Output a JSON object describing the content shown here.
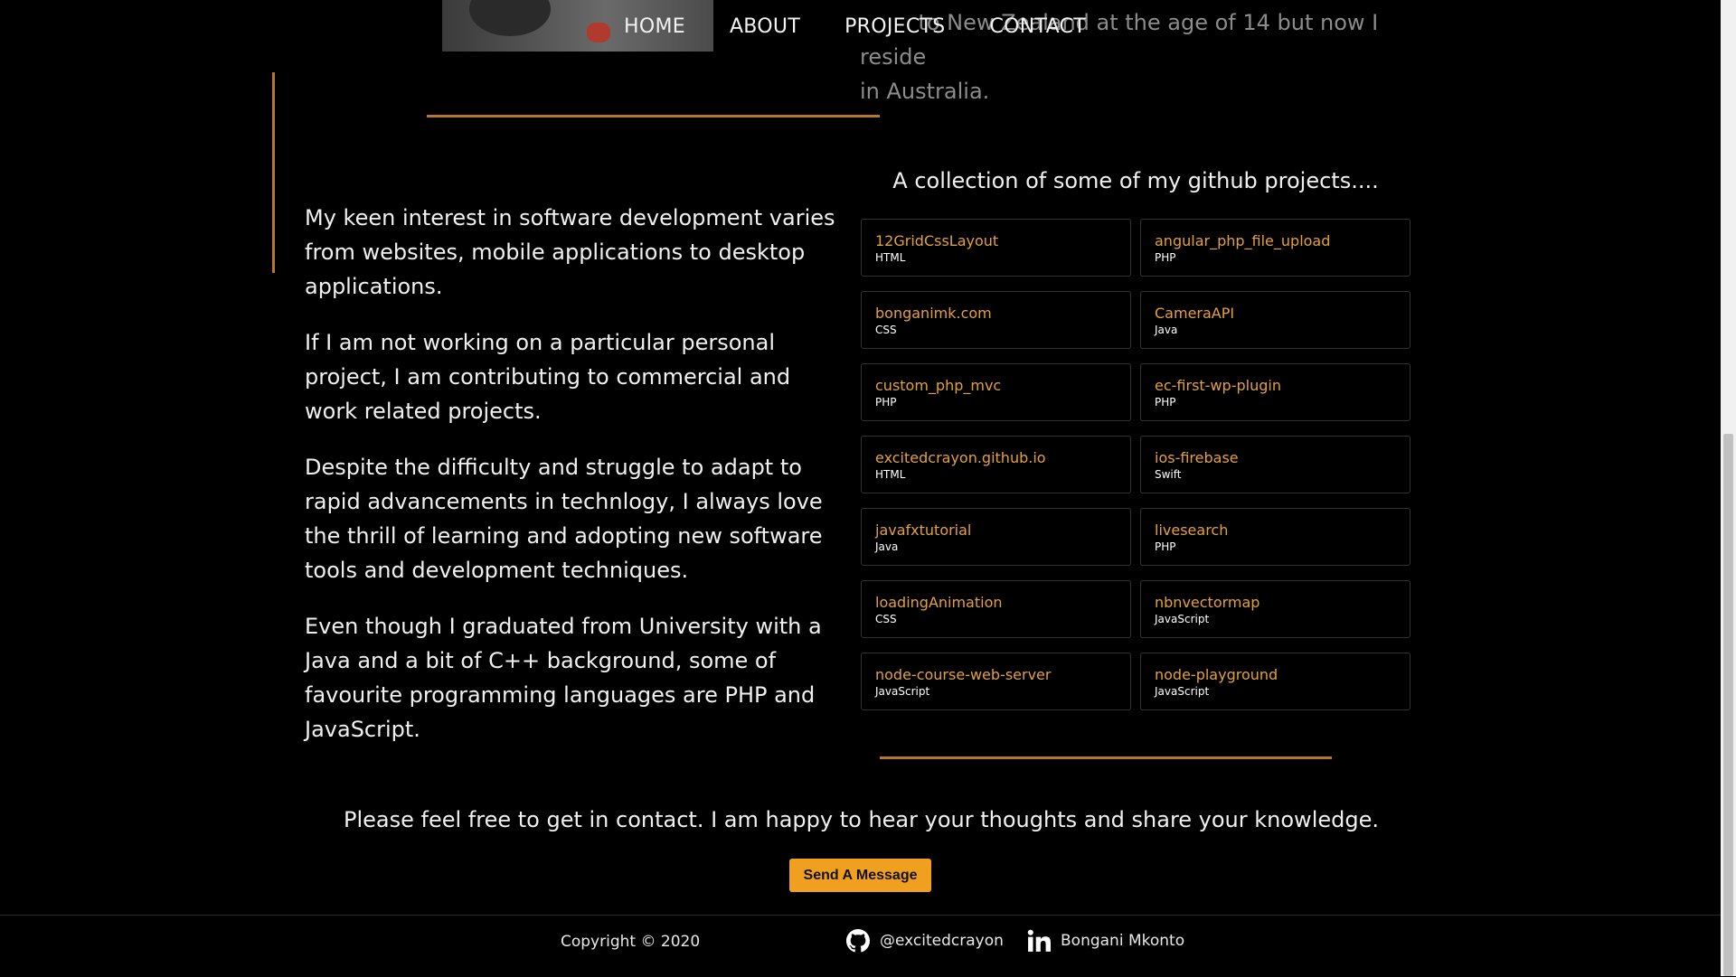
{
  "top": {
    "faded_line1_visible": "to New Zealand at the age of 14 but now I reside",
    "faded_line2": "in Australia."
  },
  "nav": {
    "items": [
      "HOME",
      "ABOUT",
      "PROJECTS",
      "CONTACT"
    ]
  },
  "about": {
    "paragraphs": [
      "My keen interest in software development varies from websites, mobile applications to desktop applications.",
      "If I am not working on a particular personal project, I am contributing to commercial and work related projects.",
      "Despite the difficulty and struggle to adapt to rapid advancements in technlogy, I always love the thrill of learning and adopting new software tools and development techniques.",
      "Even though I graduated from University with a Java and a bit of C++ background, some of favourite programming languages are PHP and JavaScript."
    ]
  },
  "projects": {
    "heading": "A collection of some of my github projects....",
    "items": [
      {
        "name": "12GridCssLayout",
        "lang": "HTML"
      },
      {
        "name": "angular_php_file_upload",
        "lang": "PHP"
      },
      {
        "name": "bonganimk.com",
        "lang": "CSS"
      },
      {
        "name": "CameraAPI",
        "lang": "Java"
      },
      {
        "name": "custom_php_mvc",
        "lang": "PHP"
      },
      {
        "name": "ec-first-wp-plugin",
        "lang": "PHP"
      },
      {
        "name": "excitedcrayon.github.io",
        "lang": "HTML"
      },
      {
        "name": "ios-firebase",
        "lang": "Swift"
      },
      {
        "name": "javafxtutorial",
        "lang": "Java"
      },
      {
        "name": "livesearch",
        "lang": "PHP"
      },
      {
        "name": "loadingAnimation",
        "lang": "CSS"
      },
      {
        "name": "nbnvectormap",
        "lang": "JavaScript"
      },
      {
        "name": "node-course-web-server",
        "lang": "JavaScript"
      },
      {
        "name": "node-playground",
        "lang": "JavaScript"
      }
    ]
  },
  "contact": {
    "text": "Please feel free to get in contact. I am happy to hear your thoughts and share your knowledge.",
    "button_label": "Send A Message"
  },
  "footer": {
    "copyright": "Copyright © 2020",
    "github_handle": "@excitedcrayon",
    "linkedin_name": "Bongani Mkonto"
  },
  "colors": {
    "accent": "#e3a03e",
    "button": "#f0a01e",
    "divider": "#b5782a"
  }
}
